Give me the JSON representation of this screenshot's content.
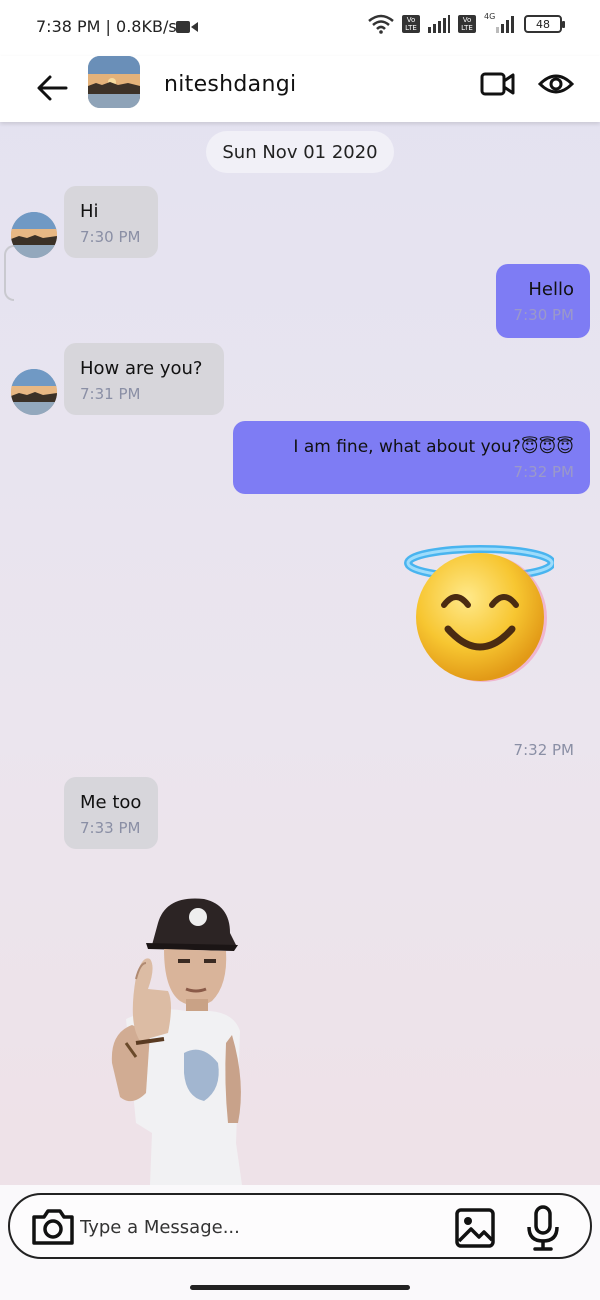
{
  "status_bar": {
    "time": "7:38 PM | 0.8KB/s",
    "network_label": "4G",
    "volte_label": "Vo LTE",
    "battery": "48"
  },
  "header": {
    "contact_name": "niteshdangi",
    "icons": [
      "back-arrow-icon",
      "video-call-icon",
      "eye-icon"
    ]
  },
  "chat": {
    "date_label": "Sun Nov 01 2020",
    "messages": [
      {
        "direction": "incoming",
        "text": "Hi",
        "time": "7:30 PM"
      },
      {
        "direction": "outgoing",
        "text": "Hello",
        "time": "7:30 PM"
      },
      {
        "direction": "incoming",
        "text": "How are you?",
        "time": "7:31 PM"
      },
      {
        "direction": "outgoing",
        "text": "I am fine, what about you?😇😇😇",
        "time": "7:32 PM"
      },
      {
        "direction": "outgoing",
        "type": "sticker",
        "sticker": "smiling-face-with-halo",
        "time": "7:32 PM"
      },
      {
        "direction": "incoming",
        "text": "Me too",
        "time": "7:33 PM"
      },
      {
        "direction": "incoming",
        "type": "sticker",
        "sticker": "thumbs-up-person"
      }
    ]
  },
  "composer": {
    "placeholder": "Type a Message...",
    "icons": [
      "camera-icon",
      "image-icon",
      "microphone-icon"
    ]
  },
  "colors": {
    "incoming_bubble": "#d7d6db",
    "outgoing_bubble": "#7e7cf4",
    "timestamp": "#8a8fa5"
  }
}
